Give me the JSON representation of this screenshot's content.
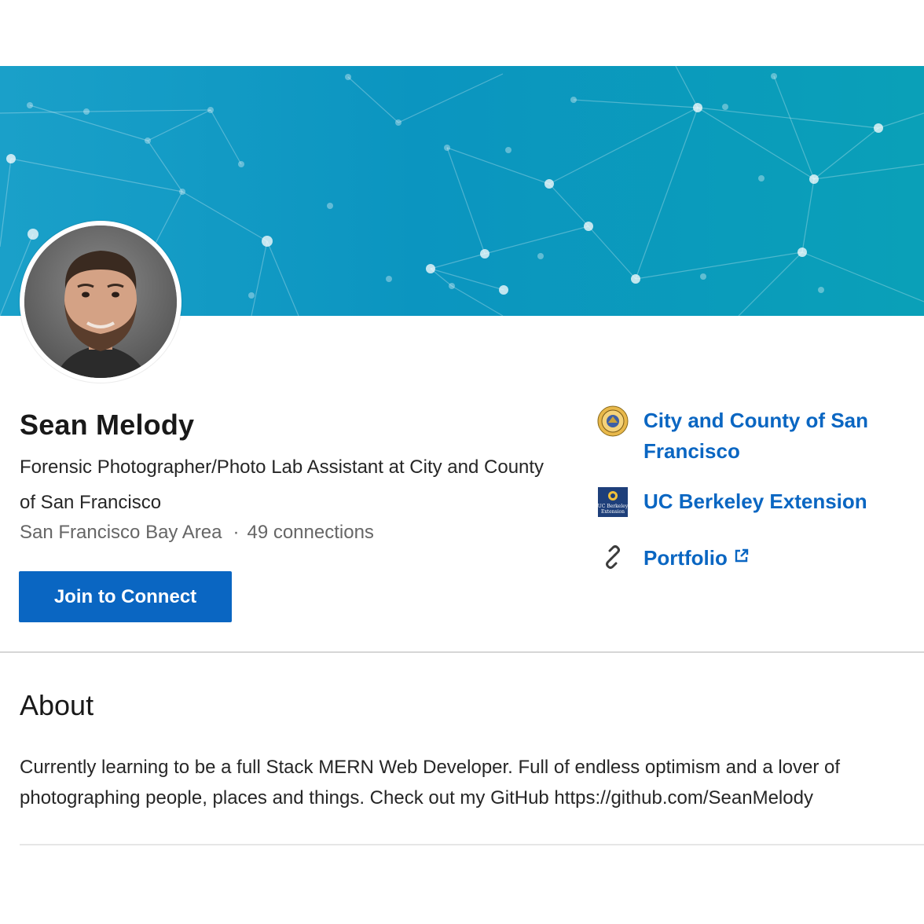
{
  "profile": {
    "name": "Sean Melody",
    "headline": "Forensic Photographer/Photo Lab Assistant at City and County of San Francisco",
    "location": "San Francisco Bay Area",
    "separator": "·",
    "connections": "49 connections",
    "join_label": "Join to Connect"
  },
  "links": {
    "items": [
      {
        "label": "City and County of San Francisco",
        "icon": "city-county-seal-icon"
      },
      {
        "label": "UC Berkeley Extension",
        "icon": "uc-berkeley-extension-logo",
        "logo_text": "UC Berkeley Extension"
      },
      {
        "label": "Portfolio",
        "icon": "link-chain-icon",
        "external_icon": "external-link-icon"
      }
    ]
  },
  "about": {
    "title": "About",
    "text": "Currently learning to be a full Stack MERN Web Developer. Full of endless optimism and a lover of photographing people, places and things. Check out my GitHub https://github.com/SeanMelody"
  },
  "colors": {
    "accent": "#0a66c2",
    "banner_start": "#1aa0c9",
    "banner_end": "#0aa0b8"
  }
}
